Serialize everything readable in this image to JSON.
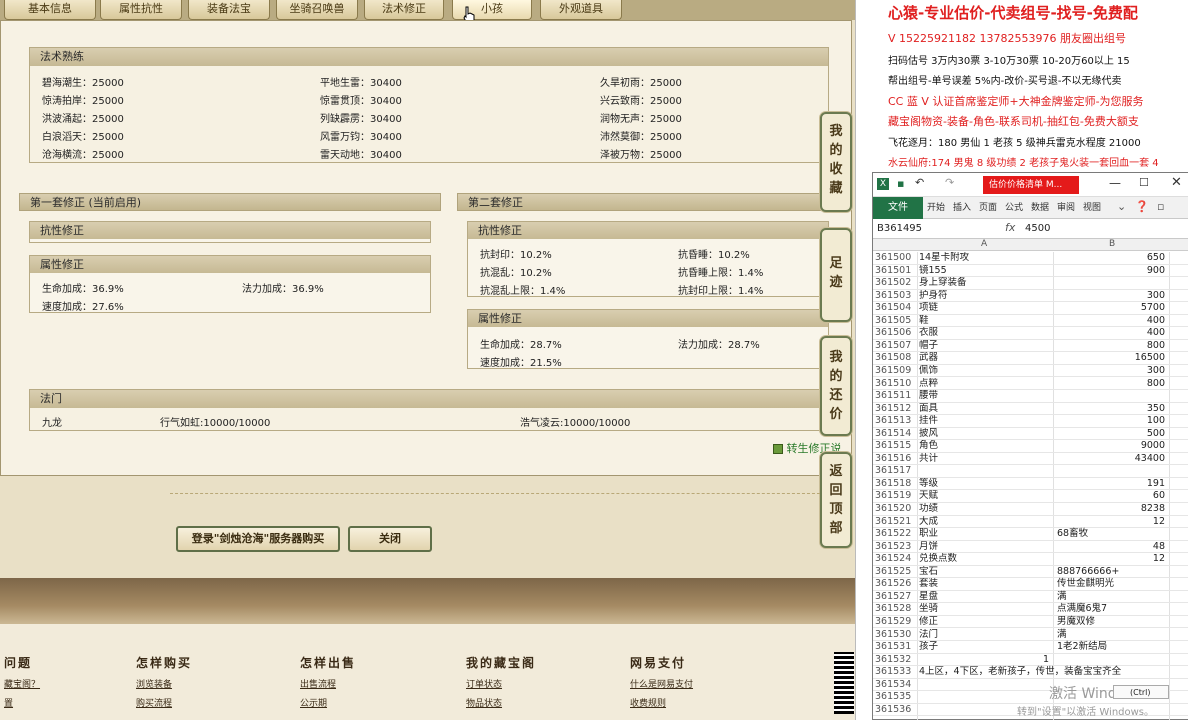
{
  "tabs": [
    "基本信息",
    "属性抗性",
    "装备法宝",
    "坐骑召唤兽",
    "法术修正",
    "小孩",
    "外观道具"
  ],
  "fashu": {
    "title": "法术熟练",
    "rows": [
      [
        "碧海潮生：25000",
        "平地生雷：30400",
        "久旱初雨：25000"
      ],
      [
        "惊涛拍岸：25000",
        "惊雷贯顶：30400",
        "兴云致雨：25000"
      ],
      [
        "洪波涌起：25000",
        "列缺霹雳：30400",
        "润物无声：25000"
      ],
      [
        "白浪滔天：25000",
        "风雷万钧：30400",
        "沛然莫御：25000"
      ],
      [
        "沧海横流：25000",
        "雷天动地：30400",
        "泽被万物：25000"
      ]
    ]
  },
  "set1": {
    "title": "第一套修正 (当前启用)",
    "kang_title": "抗性修正",
    "shu_title": "属性修正",
    "shu_rows": [
      [
        "生命加成：36.9%",
        "法力加成：36.9%"
      ],
      [
        "速度加成：27.6%",
        ""
      ]
    ]
  },
  "set2": {
    "title": "第二套修正",
    "kang_title": "抗性修正",
    "kang_rows": [
      [
        "抗封印：10.2%",
        "抗昏睡：10.2%"
      ],
      [
        "抗混乱：10.2%",
        "抗昏睡上限：1.4%"
      ],
      [
        "抗混乱上限：1.4%",
        "抗封印上限：1.4%"
      ]
    ],
    "shu_title": "属性修正",
    "shu_rows": [
      [
        "生命加成：28.7%",
        "法力加成：28.7%"
      ],
      [
        "速度加成：21.5%",
        ""
      ]
    ]
  },
  "famen": {
    "title": "法门",
    "items": [
      "九龙",
      "行气如虹:10000/10000",
      "浩气凌云:10000/10000"
    ]
  },
  "sidebar": [
    "我的收藏",
    "足迹",
    "我的还价",
    "返回顶部"
  ],
  "buttons": {
    "login": "登录\"剑烛沧海\"服务器购买",
    "close": "关闭"
  },
  "partial_link": "转生修正说",
  "footer": {
    "cols": [
      {
        "title": "问题",
        "links": [
          "藏宝阁？",
          "置"
        ]
      },
      {
        "title": "怎样购买",
        "links": [
          "浏览装备",
          "购买流程"
        ]
      },
      {
        "title": "怎样出售",
        "links": [
          "出售流程",
          "公示期"
        ]
      },
      {
        "title": "我的藏宝阁",
        "links": [
          "订单状态",
          "物品状态"
        ]
      },
      {
        "title": "网易支付",
        "links": [
          "什么是网易支付",
          "收费规则"
        ]
      }
    ]
  },
  "ad": {
    "headline": "心猿-专业估价-代卖组号-找号-免费配",
    "lines": [
      {
        "text": "V 15225921182   13782553976 朋友圈出组号",
        "color": "#e02020"
      },
      {
        "text": "扫码估号 3万内30票 3-10万30票 10-20万60以上 15",
        "color": "#111"
      },
      {
        "text": "帮出组号-单号误差 5%内-改价-买号退-不以无缘代卖",
        "color": "#111"
      },
      {
        "text": "CC 蓝 V 认证首席鉴定师+大神金牌鉴定师-为您服务",
        "color": "#e02020"
      },
      {
        "text": "藏宝阁物资-装备-角色-联系司机-抽红包-免费大额支",
        "color": "#e02020"
      },
      {
        "text": "飞花逐月：180 男仙 1 老孩 5 级神兵雷克水程度 21000",
        "color": "#111"
      },
      {
        "text": "水云仙府:174 男鬼 8 级功绩 2 老孩子鬼火装一套回血一套 4",
        "color": "#e02020"
      }
    ]
  },
  "excel": {
    "title_tab": "估价价格清单 M...",
    "ribbon": [
      "文件",
      "开始",
      "插入",
      "页面",
      "公式",
      "数据",
      "审阅",
      "视图"
    ],
    "cell_ref": "B361495",
    "formula": "4500",
    "col_a": "A",
    "col_b": "B",
    "rows": [
      [
        "361500",
        "14星卡附攻",
        "650"
      ],
      [
        "361501",
        "镜155",
        "900"
      ],
      [
        "361502",
        "身上穿装备",
        ""
      ],
      [
        "361503",
        "护身符",
        "300"
      ],
      [
        "361504",
        "项链",
        "5700"
      ],
      [
        "361505",
        "鞋",
        "400"
      ],
      [
        "361506",
        "衣服",
        "400"
      ],
      [
        "361507",
        "帽子",
        "800"
      ],
      [
        "361508",
        "武器",
        "16500"
      ],
      [
        "361509",
        "佩饰",
        "300"
      ],
      [
        "361510",
        "点粹",
        "800"
      ],
      [
        "361511",
        "腰带",
        ""
      ],
      [
        "361512",
        "面具",
        "350"
      ],
      [
        "361513",
        "挂件",
        "100"
      ],
      [
        "361514",
        "披风",
        "500"
      ],
      [
        "361515",
        "角色",
        "9000"
      ],
      [
        "361516",
        "共计",
        "43400"
      ],
      [
        "361517",
        "",
        ""
      ],
      [
        "361518",
        "等级",
        "191"
      ],
      [
        "361519",
        "天赋",
        "60"
      ],
      [
        "361520",
        "功绩",
        "8238"
      ],
      [
        "361521",
        "大成",
        "12"
      ],
      [
        "361522",
        "职业",
        "68畜牧"
      ],
      [
        "361523",
        "月饼",
        "48"
      ],
      [
        "361524",
        "兑换点数",
        "12"
      ],
      [
        "361525",
        "宝石",
        "888766666+"
      ],
      [
        "361526",
        "套装",
        "传世金麒明光"
      ],
      [
        "361527",
        "星盘",
        "满"
      ],
      [
        "361528",
        "坐骑",
        "点满魔6鬼7"
      ],
      [
        "361529",
        "修正",
        "男魔双修"
      ],
      [
        "361530",
        "法门",
        "满"
      ],
      [
        "361531",
        "孩子",
        "1老2新结局"
      ],
      [
        "361532",
        "",
        "1"
      ],
      [
        "361533",
        "4上区，4下区，老新孩子，传世，装备宝宝齐全",
        ""
      ],
      [
        "361534",
        "",
        ""
      ],
      [
        "361535",
        "",
        ""
      ],
      [
        "361536",
        "",
        ""
      ]
    ],
    "watermark1": "激活 Windows",
    "watermark2": "转到\"设置\"以激活 Windows。",
    "paste": "(Ctrl)"
  }
}
